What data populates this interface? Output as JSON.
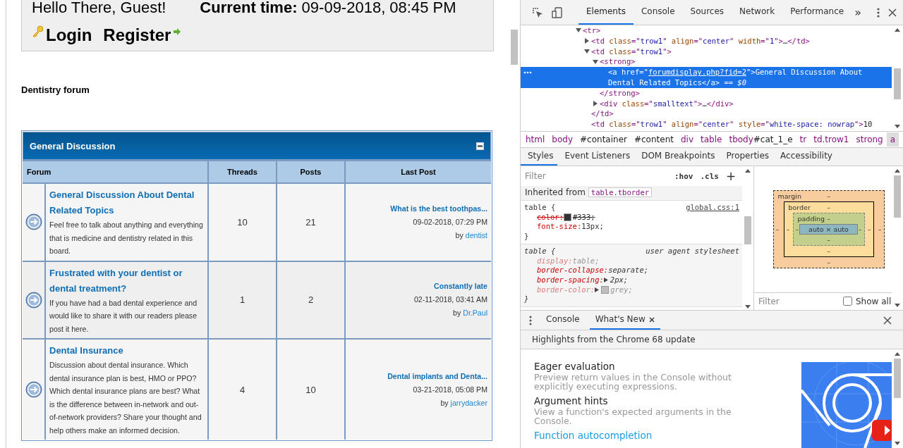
{
  "page": {
    "greeting": "Hello There, Guest!",
    "current_time": "**Current time:** 09-09-2018, 08:45 PM",
    "login": "Login",
    "register": "Register",
    "forum_title": "Dentistry forum",
    "category": {
      "title": "General Discussion",
      "expanded": true
    },
    "columns": [
      "Forum",
      "Threads",
      "Posts",
      "Last Post"
    ],
    "rows": [
      {
        "title": "General Discussion About Dental Related Topics",
        "description": "Feel free to talk about anything and everything that is medicine and dentistry related in this board.",
        "threads": "10",
        "posts": "21",
        "last_post": {
          "title": "What is the best toothpas...",
          "date": "09-02-2018, 07:29 PM",
          "by": "by",
          "author": "dentist"
        }
      },
      {
        "title": "Frustrated with your dentist or dental treatment?",
        "description": "If you have had a bad dental experience and would like to share it with our readers please post it here.",
        "threads": "1",
        "posts": "2",
        "last_post": {
          "title": "Constantly late",
          "date": "02-11-2018, 03:41 AM",
          "by": "by",
          "author": "Dr.Paul"
        }
      },
      {
        "title": "Dental Insurance",
        "description": "Discussion about dental insurance. Which dental insurance plan is best, HMO or PPO? Which dental insurance plans are best? What is the difference between in-network and out-of-network providers? Share your thought and help others make an informed decision.",
        "threads": "4",
        "posts": "10",
        "last_post": {
          "title": "Dental implants and Denta...",
          "date": "03-21-2018, 05:08 PM",
          "by": "by",
          "author": "jarrydacker"
        }
      }
    ]
  },
  "devtools": {
    "tabs": [
      {
        "label": "Elements",
        "selected": true
      },
      {
        "label": "Console",
        "selected": false
      },
      {
        "label": "Sources",
        "selected": false
      },
      {
        "label": "Network",
        "selected": false
      },
      {
        "label": "Performance",
        "selected": false
      }
    ],
    "more": "»",
    "dom_tree": [
      {
        "kind": "parent",
        "expanded": true,
        "selected": false,
        "open": [
          {
            "kind": "tag",
            "text": "<tr>"
          }
        ],
        "children": [
          {
            "kind": "parent",
            "expanded": false,
            "selected": false,
            "open": [
              {
                "kind": "tag",
                "text": "<td "
              },
              {
                "kind": "attr",
                "text": "class"
              },
              {
                "kind": "tag",
                "text": "=\""
              },
              {
                "kind": "val",
                "text": "trow1"
              },
              {
                "kind": "tag",
                "text": "\" "
              },
              {
                "kind": "attr",
                "text": "align"
              },
              {
                "kind": "tag",
                "text": "=\""
              },
              {
                "kind": "val",
                "text": "center"
              },
              {
                "kind": "tag",
                "text": "\" "
              },
              {
                "kind": "attr",
                "text": "width"
              },
              {
                "kind": "tag",
                "text": "=\""
              },
              {
                "kind": "val",
                "text": "1"
              },
              {
                "kind": "tag",
                "text": "\">"
              },
              {
                "kind": "text",
                "text": "…"
              },
              {
                "kind": "tag",
                "text": "</td>"
              }
            ]
          },
          {
            "kind": "parent",
            "expanded": true,
            "selected": false,
            "open": [
              {
                "kind": "tag",
                "text": "<td "
              },
              {
                "kind": "attr",
                "text": "class"
              },
              {
                "kind": "tag",
                "text": "=\""
              },
              {
                "kind": "val",
                "text": "trow1"
              },
              {
                "kind": "tag",
                "text": "\">"
              }
            ],
            "close": [
              {
                "kind": "tag",
                "text": "</td>"
              }
            ],
            "children": [
              {
                "kind": "parent",
                "expanded": true,
                "selected": false,
                "open": [
                  {
                    "kind": "tag",
                    "text": "<strong>"
                  }
                ],
                "close": [
                  {
                    "kind": "tag",
                    "text": "</strong>"
                  }
                ],
                "children": [
                  {
                    "kind": "leaf",
                    "selected": true,
                    "open": [
                      {
                        "kind": "tag",
                        "text": "<a "
                      },
                      {
                        "kind": "attr",
                        "text": "href"
                      },
                      {
                        "kind": "tag",
                        "text": "=\""
                      },
                      {
                        "kind": "link",
                        "text": "forumdisplay.php?fid=2"
                      },
                      {
                        "kind": "tag",
                        "text": "\">"
                      },
                      {
                        "kind": "text",
                        "text": "General Discussion About Dental Related Topics"
                      },
                      {
                        "kind": "tag",
                        "text": "</a>"
                      },
                      {
                        "kind": "dim",
                        "text": " == $0"
                      }
                    ]
                  }
                ]
              },
              {
                "kind": "parent",
                "expanded": false,
                "selected": false,
                "open": [
                  {
                    "kind": "tag",
                    "text": "<div "
                  },
                  {
                    "kind": "attr",
                    "text": "class"
                  },
                  {
                    "kind": "tag",
                    "text": "=\""
                  },
                  {
                    "kind": "val",
                    "text": "smalltext"
                  },
                  {
                    "kind": "tag",
                    "text": "\">"
                  },
                  {
                    "kind": "text",
                    "text": "…"
                  },
                  {
                    "kind": "tag",
                    "text": "</div>"
                  }
                ]
              }
            ]
          },
          {
            "kind": "leaf",
            "selected": false,
            "open": [
              {
                "kind": "tag",
                "text": "<td "
              },
              {
                "kind": "attr",
                "text": "class"
              },
              {
                "kind": "tag",
                "text": "=\""
              },
              {
                "kind": "val",
                "text": "trow1"
              },
              {
                "kind": "tag",
                "text": "\" "
              },
              {
                "kind": "attr",
                "text": "align"
              },
              {
                "kind": "tag",
                "text": "=\""
              },
              {
                "kind": "val",
                "text": "center"
              },
              {
                "kind": "tag",
                "text": "\" "
              },
              {
                "kind": "attr",
                "text": "style"
              },
              {
                "kind": "tag",
                "text": "=\""
              },
              {
                "kind": "val",
                "text": "white-space: nowrap"
              },
              {
                "kind": "tag",
                "text": "\">"
              },
              {
                "kind": "text",
                "text": "10"
              }
            ]
          }
        ]
      }
    ],
    "breadcrumbs": [
      {
        "tag": "html",
        "selected": false
      },
      {
        "tag": "body",
        "selected": false
      },
      {
        "id": "#container",
        "selected": false
      },
      {
        "id": "#content",
        "selected": false
      },
      {
        "tag": "div",
        "selected": false
      },
      {
        "tag": "table",
        "selected": false
      },
      {
        "tag": "tbody",
        "id": "#cat_1_e",
        "selected": false
      },
      {
        "tag": "tr",
        "selected": false
      },
      {
        "tag": "td.trow1",
        "selected": false
      },
      {
        "tag": "strong",
        "selected": false
      },
      {
        "tag": "a",
        "selected": true
      }
    ],
    "styles_tabs": [
      {
        "label": "Styles",
        "selected": true
      },
      {
        "label": "Event Listeners",
        "selected": false
      },
      {
        "label": "DOM Breakpoints",
        "selected": false
      },
      {
        "label": "Properties",
        "selected": false
      },
      {
        "label": "Accessibility",
        "selected": false
      }
    ],
    "styles": {
      "filter_placeholder": "Filter",
      "hov": ":hov",
      "cls": ".cls",
      "add": "+",
      "inherited_label": "Inherited from",
      "inherited_selector": "table.tborder",
      "rules": [
        {
          "kind": "author",
          "selector": "table {",
          "source": "global.css:1",
          "close": "}",
          "props": [
            {
              "name": "color:",
              "value": "#333;",
              "overridden": true,
              "inactive": false,
              "expandable": false,
              "color": "#333333"
            },
            {
              "name": "font-size:",
              "value": "13px;",
              "overridden": false,
              "inactive": false,
              "expandable": false
            }
          ]
        },
        {
          "kind": "user-agent",
          "selector": "table {",
          "source": "user agent stylesheet",
          "close": "}",
          "props": [
            {
              "name": "display:",
              "value": "table;",
              "overridden": false,
              "inactive": true,
              "expandable": false
            },
            {
              "name": "border-collapse:",
              "value": "separate;",
              "overridden": false,
              "inactive": false,
              "expandable": false
            },
            {
              "name": "border-spacing:",
              "value": "2px;",
              "overridden": false,
              "inactive": false,
              "expandable": true
            },
            {
              "name": "border-color:",
              "value": "grey;",
              "overridden": false,
              "inactive": true,
              "expandable": true,
              "color": "#bebebe"
            }
          ]
        }
      ]
    },
    "box_model": {
      "margin": {
        "label": "margin",
        "top": "–",
        "right": "–",
        "bottom": "–",
        "left": "–"
      },
      "border": {
        "label": "border",
        "top": "–",
        "right": "–",
        "bottom": "–",
        "left": "–"
      },
      "padding": {
        "label": "padding",
        "top": "–",
        "right": "–",
        "bottom": "–",
        "left": "–"
      },
      "content": "auto × auto"
    },
    "computed": {
      "filter_placeholder": "Filter",
      "show_all": {
        "label": "Show all",
        "checked": false
      }
    },
    "drawer": {
      "tabs": [
        {
          "label": "Console",
          "selected": false,
          "closable": false
        },
        {
          "label": "What's New",
          "selected": true,
          "closable": true
        }
      ],
      "headline": "Highlights from the Chrome 68 update",
      "items": [
        {
          "kind": "feature",
          "title": "Eager evaluation",
          "description": "Preview return values in the Console without explicitly executing expressions."
        },
        {
          "kind": "feature",
          "title": "Argument hints",
          "description": "View a function's expected arguments in the Console."
        },
        {
          "kind": "link",
          "title": "Function autocompletion"
        }
      ]
    }
  }
}
